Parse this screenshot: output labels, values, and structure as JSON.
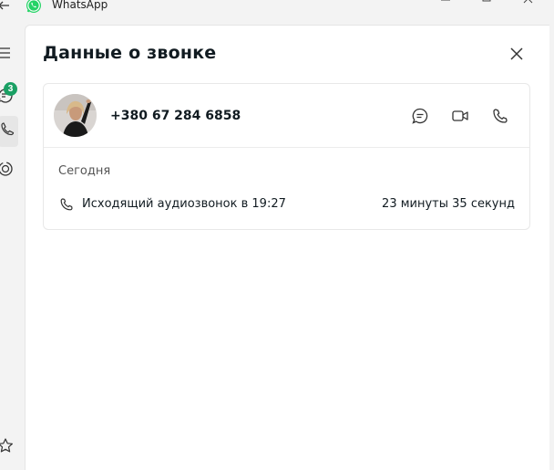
{
  "app": {
    "title": "WhatsApp"
  },
  "rail": {
    "chats_badge": "3"
  },
  "panel": {
    "title": "Данные о звонке"
  },
  "contact": {
    "phone": "+380 67 284 6858"
  },
  "history": {
    "section_label": "Сегодня",
    "calls": [
      {
        "description": "Исходящий аудиозвонок в 19:27",
        "duration": "23 минуты 35 секунд"
      }
    ]
  },
  "colors": {
    "badge": "#1aa064",
    "brand": "#25d366"
  }
}
